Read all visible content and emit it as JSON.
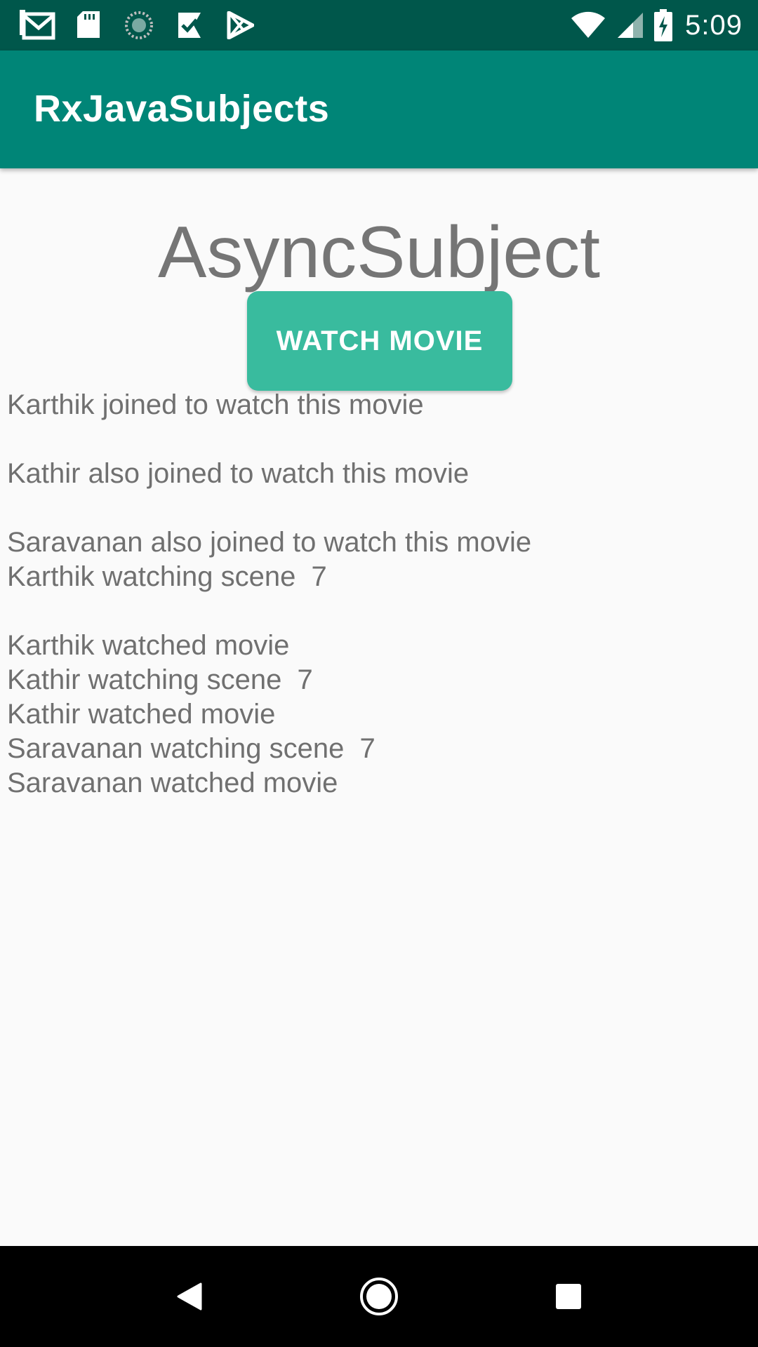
{
  "status_bar": {
    "time": "5:09",
    "left_icons": [
      "gmail-icon",
      "sd-card-icon",
      "sync-progress-icon",
      "task-check-icon",
      "play-store-icon"
    ],
    "right_icons": [
      "wifi-icon",
      "cell-signal-icon",
      "battery-charging-icon"
    ]
  },
  "app_bar": {
    "title": "RxJavaSubjects"
  },
  "main": {
    "heading": "AsyncSubject",
    "button_label": "WATCH MOVIE",
    "log_lines": [
      "Karthik joined to watch this movie",
      "Kathir also joined to watch this movie",
      "Saravanan also joined to watch this movie",
      "Karthik watching scene  7",
      "Karthik watched movie",
      "Kathir watching scene  7",
      "Kathir watched movie",
      "Saravanan watching scene  7",
      "Saravanan watched movie"
    ]
  },
  "nav_bar": {
    "buttons": [
      "back-icon",
      "home-icon",
      "recents-icon"
    ]
  },
  "colors": {
    "status_bar": "#00574b",
    "app_bar": "#008577",
    "accent_button": "#39bb9e",
    "background": "#fafafa",
    "text_secondary": "#757575"
  }
}
